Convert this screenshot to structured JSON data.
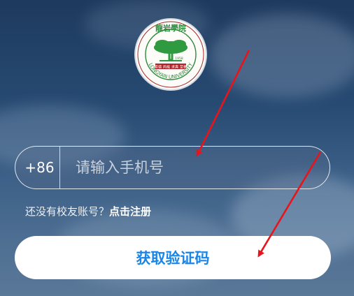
{
  "logo": {
    "top_text": "龍岩學院",
    "motto": "崇德 尚能 求真 至善",
    "year": "1958",
    "ring_text": "LONGYAN UNIVERSITY"
  },
  "phone": {
    "country_code": "+86",
    "placeholder": "请输入手机号"
  },
  "register": {
    "prompt": "还没有校友账号？",
    "link": "点击注册"
  },
  "get_code_button": {
    "label": "获取验证码"
  },
  "colors": {
    "accent_blue": "#1a85e8",
    "annotation_red": "#e8141b"
  }
}
